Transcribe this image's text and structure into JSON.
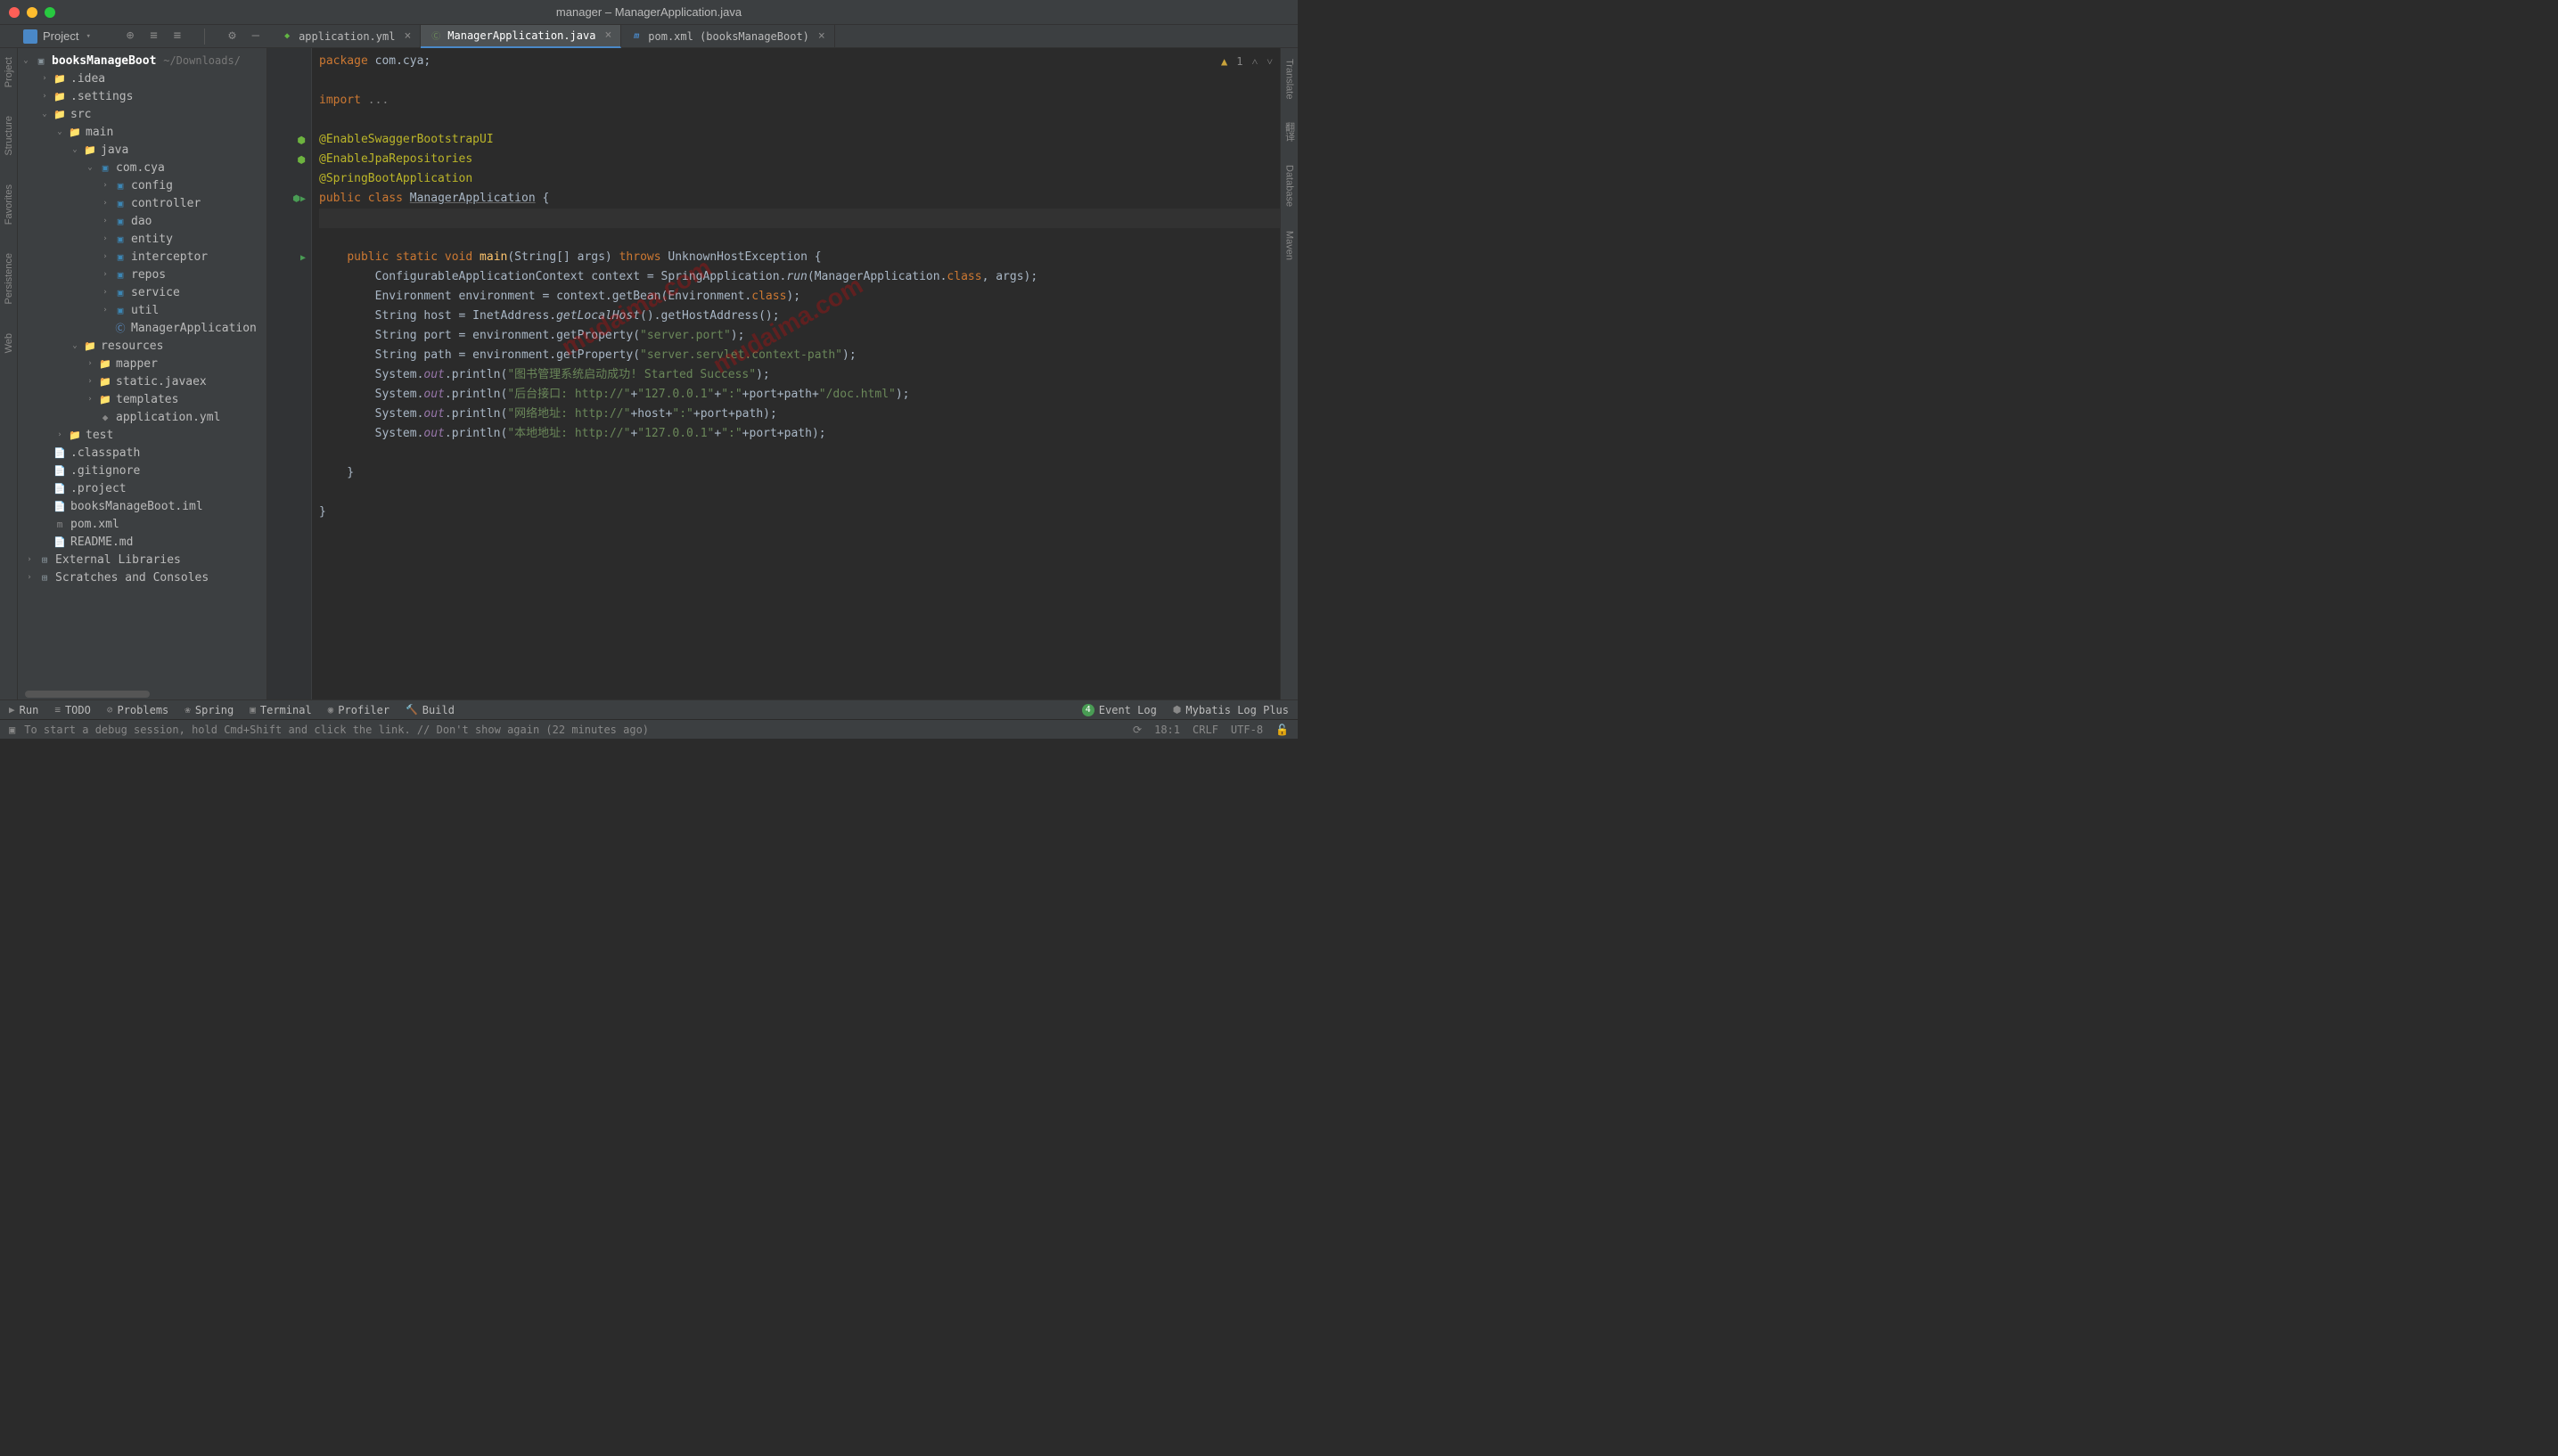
{
  "window": {
    "title": "manager – ManagerApplication.java"
  },
  "toolbar": {
    "project_label": "Project"
  },
  "tabs": [
    {
      "label": "application.yml",
      "active": false,
      "icon": "yml"
    },
    {
      "label": "ManagerApplication.java",
      "active": true,
      "icon": "java"
    },
    {
      "label": "pom.xml (booksManageBoot)",
      "active": false,
      "icon": "pom"
    }
  ],
  "tree": {
    "root": {
      "name": "booksManageBoot",
      "path": "~/Downloads/"
    },
    "nodes": [
      {
        "name": ".idea",
        "depth": 1,
        "icon": "folder",
        "arrow": "›"
      },
      {
        "name": ".settings",
        "depth": 1,
        "icon": "folder",
        "arrow": "›"
      },
      {
        "name": "src",
        "depth": 1,
        "icon": "folder",
        "arrow": "⌄"
      },
      {
        "name": "main",
        "depth": 2,
        "icon": "folder",
        "arrow": "⌄"
      },
      {
        "name": "java",
        "depth": 3,
        "icon": "folder-src",
        "arrow": "⌄"
      },
      {
        "name": "com.cya",
        "depth": 4,
        "icon": "pkg",
        "arrow": "⌄"
      },
      {
        "name": "config",
        "depth": 5,
        "icon": "pkg",
        "arrow": "›"
      },
      {
        "name": "controller",
        "depth": 5,
        "icon": "pkg",
        "arrow": "›"
      },
      {
        "name": "dao",
        "depth": 5,
        "icon": "pkg",
        "arrow": "›"
      },
      {
        "name": "entity",
        "depth": 5,
        "icon": "pkg",
        "arrow": "›"
      },
      {
        "name": "interceptor",
        "depth": 5,
        "icon": "pkg",
        "arrow": "›"
      },
      {
        "name": "repos",
        "depth": 5,
        "icon": "pkg",
        "arrow": "›"
      },
      {
        "name": "service",
        "depth": 5,
        "icon": "pkg",
        "arrow": "›"
      },
      {
        "name": "util",
        "depth": 5,
        "icon": "pkg",
        "arrow": "›"
      },
      {
        "name": "ManagerApplication",
        "depth": 5,
        "icon": "java",
        "arrow": " "
      },
      {
        "name": "resources",
        "depth": 3,
        "icon": "folder-res",
        "arrow": "⌄"
      },
      {
        "name": "mapper",
        "depth": 4,
        "icon": "folder",
        "arrow": "›"
      },
      {
        "name": "static.javaex",
        "depth": 4,
        "icon": "folder",
        "arrow": "›"
      },
      {
        "name": "templates",
        "depth": 4,
        "icon": "folder",
        "arrow": "›"
      },
      {
        "name": "application.yml",
        "depth": 4,
        "icon": "yml",
        "arrow": " "
      },
      {
        "name": "test",
        "depth": 2,
        "icon": "folder",
        "arrow": "›"
      },
      {
        "name": ".classpath",
        "depth": 1,
        "icon": "file",
        "arrow": " "
      },
      {
        "name": ".gitignore",
        "depth": 1,
        "icon": "file",
        "arrow": " "
      },
      {
        "name": ".project",
        "depth": 1,
        "icon": "file",
        "arrow": " "
      },
      {
        "name": "booksManageBoot.iml",
        "depth": 1,
        "icon": "file",
        "arrow": " "
      },
      {
        "name": "pom.xml",
        "depth": 1,
        "icon": "pom",
        "arrow": " "
      },
      {
        "name": "README.md",
        "depth": 1,
        "icon": "md",
        "arrow": " "
      }
    ],
    "external": "External Libraries",
    "scratches": "Scratches and Consoles"
  },
  "left_rail": [
    "Project",
    "Structure",
    "Favorites",
    "Persistence",
    "Web"
  ],
  "right_rail": [
    "Translate",
    "翻译",
    "Database",
    "Maven"
  ],
  "editor": {
    "warnings": "1",
    "lines_tokens": [
      [
        [
          "kw",
          "package"
        ],
        [
          "",
          " com.cya;"
        ]
      ],
      [],
      [
        [
          "kw",
          "import"
        ],
        [
          "",
          " "
        ],
        [
          "comment",
          "..."
        ]
      ],
      [],
      [
        [
          "annot",
          "@EnableSwaggerBootstrapUI"
        ]
      ],
      [
        [
          "annot",
          "@EnableJpaRepositories"
        ]
      ],
      [
        [
          "annot",
          "@SpringBootApplication"
        ]
      ],
      [
        [
          "kw",
          "public "
        ],
        [
          "kw",
          "class "
        ],
        [
          "underline",
          "ManagerApplication"
        ],
        [
          "",
          " {"
        ]
      ],
      [],
      [],
      [
        [
          "",
          "    "
        ],
        [
          "kw",
          "public "
        ],
        [
          "kw",
          "static "
        ],
        [
          "kw",
          "void "
        ],
        [
          "method",
          "main"
        ],
        [
          "",
          "(String[] args) "
        ],
        [
          "kw",
          "throws"
        ],
        [
          "",
          " UnknownHostException {"
        ]
      ],
      [
        [
          "",
          "        ConfigurableApplicationContext context = SpringApplication."
        ],
        [
          "italic",
          "run"
        ],
        [
          "",
          "(ManagerApplication."
        ],
        [
          "kw",
          "class"
        ],
        [
          "",
          ", args);"
        ]
      ],
      [
        [
          "",
          "        Environment environment = context.getBean(Environment."
        ],
        [
          "kw",
          "class"
        ],
        [
          "",
          ");"
        ]
      ],
      [
        [
          "",
          "        String host = InetAddress."
        ],
        [
          "italic",
          "getLocalHost"
        ],
        [
          "",
          "().getHostAddress();"
        ]
      ],
      [
        [
          "",
          "        String port = environment.getProperty("
        ],
        [
          "str",
          "\"server.port\""
        ],
        [
          "",
          ");"
        ]
      ],
      [
        [
          "",
          "        String path = environment.getProperty("
        ],
        [
          "str",
          "\"server.servlet.context-path\""
        ],
        [
          "",
          ");"
        ]
      ],
      [
        [
          "",
          "        System."
        ],
        [
          "field",
          "out"
        ],
        [
          "",
          ".println("
        ],
        [
          "str",
          "\"图书管理系统启动成功! Started Success\""
        ],
        [
          "",
          ");"
        ]
      ],
      [
        [
          "",
          "        System."
        ],
        [
          "field",
          "out"
        ],
        [
          "",
          ".println("
        ],
        [
          "str",
          "\"后台接口: http://\""
        ],
        [
          "",
          "+"
        ],
        [
          "str",
          "\"127.0.0.1\""
        ],
        [
          "",
          "+"
        ],
        [
          "str",
          "\":\""
        ],
        [
          "",
          "+port+path+"
        ],
        [
          "str",
          "\"/doc.html\""
        ],
        [
          "",
          ");"
        ]
      ],
      [
        [
          "",
          "        System."
        ],
        [
          "field",
          "out"
        ],
        [
          "",
          ".println("
        ],
        [
          "str",
          "\"网络地址: http://\""
        ],
        [
          "",
          "+host+"
        ],
        [
          "str",
          "\":\""
        ],
        [
          "",
          "+port+path);"
        ]
      ],
      [
        [
          "",
          "        System."
        ],
        [
          "field",
          "out"
        ],
        [
          "",
          ".println("
        ],
        [
          "str",
          "\"本地地址: http://\""
        ],
        [
          "",
          "+"
        ],
        [
          "str",
          "\"127.0.0.1\""
        ],
        [
          "",
          "+"
        ],
        [
          "str",
          "\":\""
        ],
        [
          "",
          "+port+path);"
        ]
      ],
      [],
      [
        [
          "",
          "    }"
        ]
      ],
      [],
      [
        [
          "",
          "}"
        ]
      ]
    ],
    "gutter_marks": {
      "5": "spring",
      "6": "spring",
      "8": "run",
      "11": "play"
    }
  },
  "bottom": {
    "left": [
      {
        "icon": "▶",
        "label": "Run"
      },
      {
        "icon": "≡",
        "label": "TODO"
      },
      {
        "icon": "⊘",
        "label": "Problems"
      },
      {
        "icon": "❀",
        "label": "Spring"
      },
      {
        "icon": "▣",
        "label": "Terminal"
      },
      {
        "icon": "◉",
        "label": "Profiler"
      },
      {
        "icon": "🔨",
        "label": "Build"
      }
    ],
    "right": [
      {
        "badge": "4",
        "label": "Event Log"
      },
      {
        "icon": "⬢",
        "label": "Mybatis Log Plus"
      }
    ]
  },
  "status": {
    "hint": "To start a debug session, hold Cmd+Shift and click the link. // Don't show again (22 minutes ago)",
    "pos": "18:1",
    "lineend": "CRLF",
    "encoding": "UTF-8"
  },
  "watermarks": [
    "mudaima.com",
    "mudaima.com"
  ]
}
